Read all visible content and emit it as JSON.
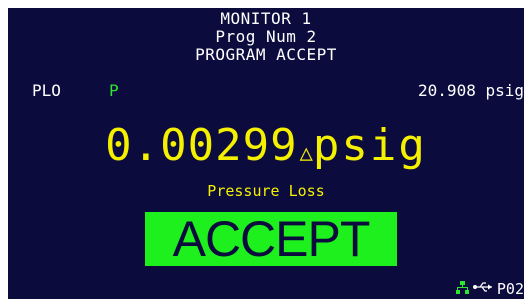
{
  "header": {
    "monitor_title": "MONITOR 1",
    "program_number": "Prog Num 2",
    "program_status": "PROGRAM ACCEPT"
  },
  "status_row": {
    "test_code": "PLO",
    "flag": "P",
    "live_pressure": "20.908 psig"
  },
  "result": {
    "value": "0.00299",
    "delta_icon": "△",
    "unit": "psig",
    "label": "Pressure Loss"
  },
  "verdict": {
    "text": "ACCEPT",
    "color": "#1ef01e"
  },
  "footer": {
    "network_icon": "network-icon",
    "usb_icon": "usb-icon",
    "port_label": "P02"
  },
  "colors": {
    "background": "#0b0b3e",
    "result_text": "#f4f000",
    "flag_green": "#2ee62e"
  }
}
